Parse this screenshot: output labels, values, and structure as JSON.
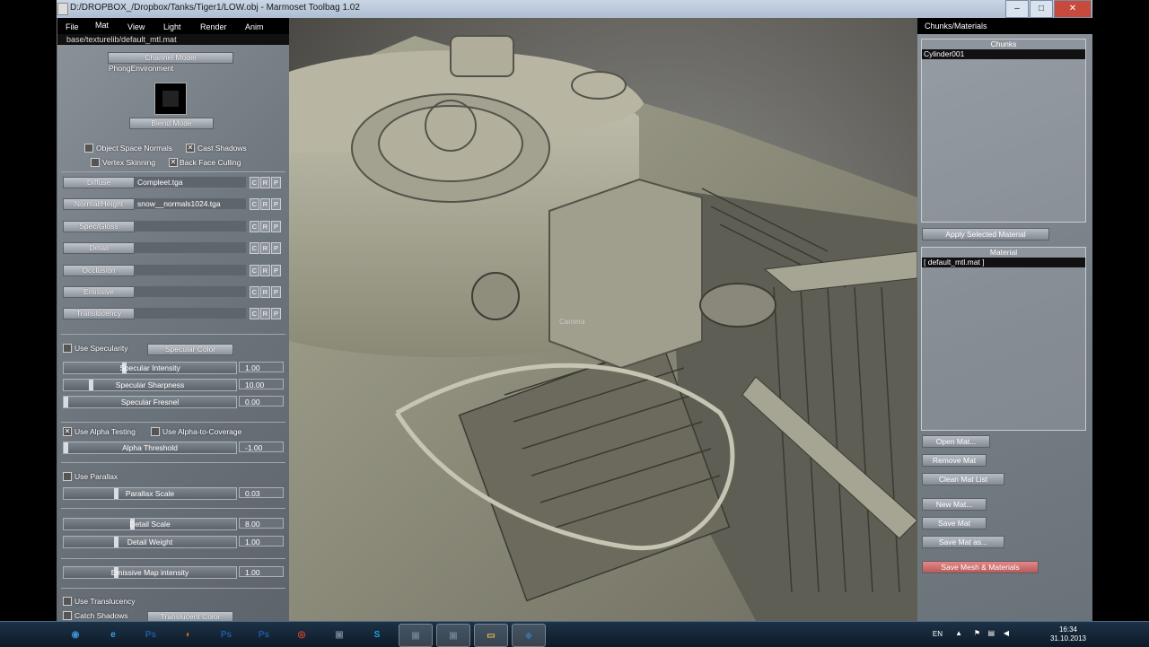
{
  "window": {
    "title": "D:/DROPBOX_/Dropbox/Tanks/Tiger1/LOW.obj - Marmoset Toolbag 1.02",
    "minimize": "–",
    "maximize": "□",
    "close": "✕"
  },
  "menu": {
    "file": "File",
    "mat": "Mat",
    "view": "View",
    "light": "Light",
    "render": "Render",
    "anim": "Anim"
  },
  "material_path": "base/texturelib/default_mtl.mat",
  "left": {
    "channel_model_button": "Channel Model",
    "channel_model_value": "PhongEnvironment",
    "blend_mode_button": "Blend Mode",
    "object_space_normals": "Object Space Normals",
    "cast_shadows": "Cast Shadows",
    "vertex_skinning": "Vertex Skinning",
    "back_face_culling": "Back Face Culling",
    "check_mark": "✕",
    "channels": [
      {
        "label": "Diffuse",
        "file": "Compleet.tga"
      },
      {
        "label": "Normal/Height",
        "file": "snow__normals1024.tga"
      },
      {
        "label": "Spec/Gloss",
        "file": ""
      },
      {
        "label": "Detail",
        "file": ""
      },
      {
        "label": "Occlusion",
        "file": ""
      },
      {
        "label": "Emissive",
        "file": ""
      },
      {
        "label": "Translucency",
        "file": ""
      }
    ],
    "crp": [
      "C",
      "R",
      "P"
    ],
    "use_specularity": "Use Specularity",
    "specular_color_button": "Specular Color",
    "sliders": [
      {
        "key": "specular-intensity",
        "label": "Specular Intensity",
        "value": "1.00",
        "level": 0.35
      },
      {
        "key": "specular-sharpness",
        "label": "Specular Sharpness",
        "value": "10.00",
        "level": 0.15
      },
      {
        "key": "specular-fresnel",
        "label": "Specular Fresnel",
        "value": "0.00",
        "level": 0.0
      },
      {
        "key": "alpha-threshold",
        "label": "Alpha Threshold",
        "value": "-1.00",
        "level": 0.0
      },
      {
        "key": "parallax-scale",
        "label": "Parallax Scale",
        "value": "0.03",
        "level": 0.3
      },
      {
        "key": "detail-scale",
        "label": "Detail Scale",
        "value": "8.00",
        "level": 0.4
      },
      {
        "key": "detail-weight",
        "label": "Detail Weight",
        "value": "1.00",
        "level": 0.3
      },
      {
        "key": "emissive-map-intensity",
        "label": "Emissive Map intensity",
        "value": "1.00",
        "level": 0.3
      }
    ],
    "use_alpha_testing": "Use Alpha Testing",
    "use_alpha_to_coverage": "Use Alpha-to-Coverage",
    "use_parallax": "Use Parallax",
    "use_translucency": "Use Translucency",
    "catch_shadows": "Catch Shadows",
    "translucent_color_button": "Translucent Color"
  },
  "viewport": {
    "camera_label": "Camera"
  },
  "right": {
    "header": "Chunks/Materials",
    "chunks_header": "Chunks",
    "chunks": [
      "Cylinder001"
    ],
    "apply_selected_material": "Apply Selected Material",
    "material_header": "Material",
    "materials": [
      "[ default_mtl.mat ]"
    ],
    "open_mat": "Open Mat...",
    "remove_mat": "Remove Mat",
    "clean_mat_list": "Clean Mat List",
    "new_mat": "New Mat...",
    "save_mat": "Save Mat",
    "save_mat_as": "Save Mat as...",
    "save_mesh_materials": "Save Mesh & Materials"
  },
  "taskbar": {
    "items": [
      "start-orb",
      "internet-explorer",
      "photoshop",
      "firefox",
      "photoshop",
      "photoshop",
      "chrome",
      "app",
      "skype",
      "app",
      "app",
      "folder",
      "marmoset"
    ],
    "language": "EN",
    "time": "16:34",
    "date": "31.10.2013"
  },
  "colors": {
    "save_mesh_red": "#d46a6a",
    "taskbar": "#16283a"
  }
}
